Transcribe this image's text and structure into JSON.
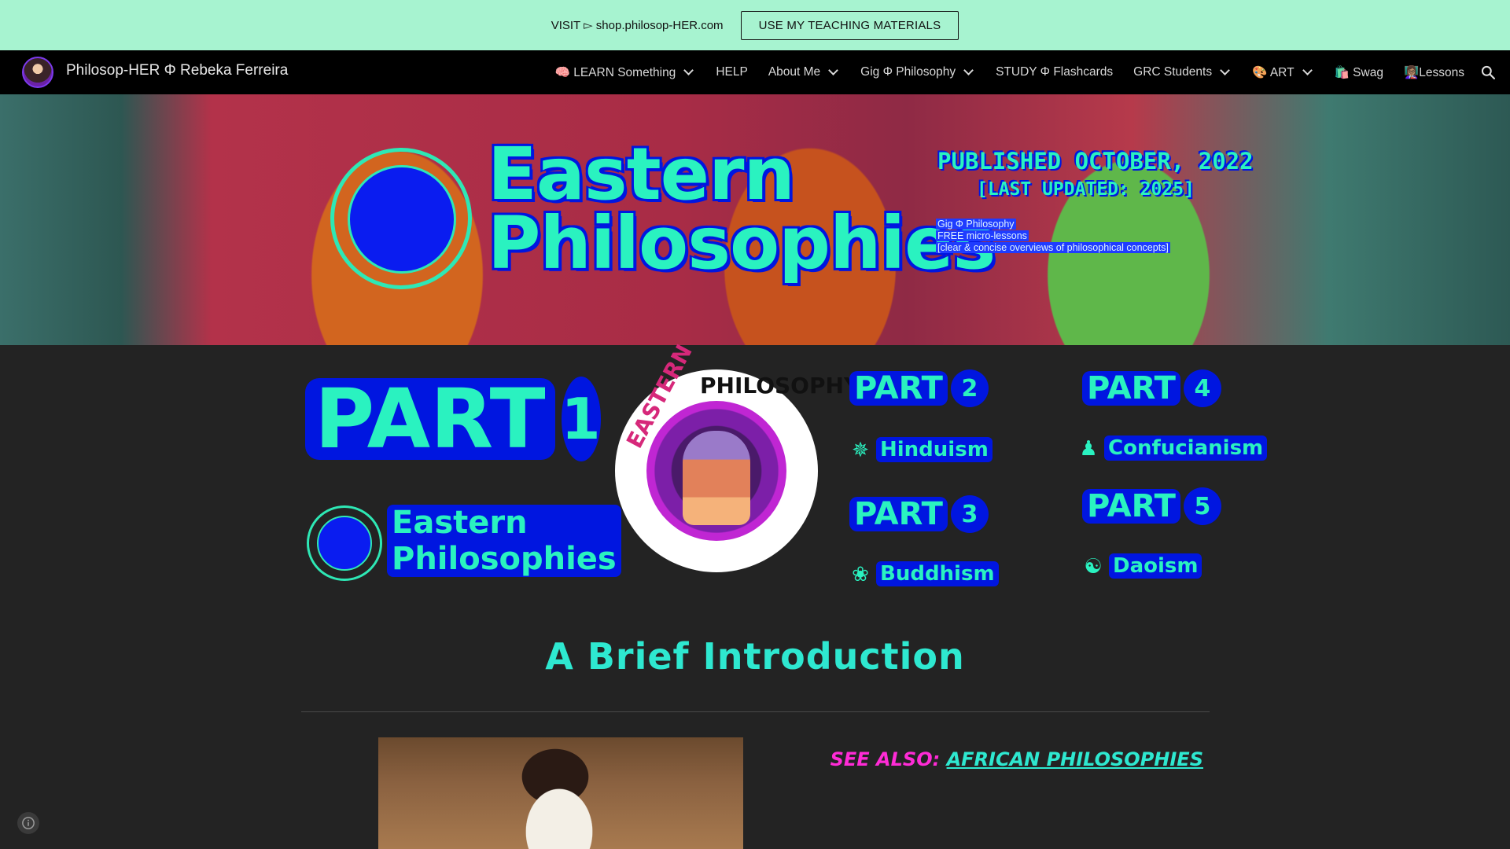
{
  "announcement": {
    "visit_text": "VISIT ▻ shop.philosop-HER.com",
    "button_label": "USE MY TEACHING MATERIALS"
  },
  "nav": {
    "site_title": "Philosop-HER Φ Rebeka Ferreira",
    "items": [
      {
        "label": "🧠 LEARN Something",
        "dropdown": true
      },
      {
        "label": "HELP",
        "dropdown": false
      },
      {
        "label": "About Me",
        "dropdown": true
      },
      {
        "label": "Gig Φ Philosophy",
        "dropdown": true
      },
      {
        "label": "STUDY Φ Flashcards",
        "dropdown": false
      },
      {
        "label": "GRC Students",
        "dropdown": true
      },
      {
        "label": "🎨 ART",
        "dropdown": true
      },
      {
        "label": "🛍️ Swag",
        "dropdown": false
      },
      {
        "label": "👩🏽‍🏫Lessons",
        "dropdown": false
      }
    ]
  },
  "hero": {
    "title_line1": "Eastern",
    "title_line2": "Philosophies",
    "published": "PUBLISHED OCTOBER, 2022",
    "updated": "[LAST UPDATED: 2025]",
    "small1": "Gig Φ Philosophy",
    "small2": "FREE micro-lessons",
    "small3": "[clear & concise overviews of philosophical concepts]"
  },
  "parts": {
    "part_word": "PART",
    "part1_num": "1",
    "small_title_line1": "Eastern",
    "small_title_line2": "Philosophies",
    "badge_word1": "EASTERN",
    "badge_word2": "PHILOSOPHY",
    "part2_num": "2",
    "part3_num": "3",
    "part4_num": "4",
    "part5_num": "5",
    "topic_hinduism": "Hinduism",
    "topic_buddhism": "Buddhism",
    "topic_confucianism": "Confucianism",
    "topic_daoism": "Daoism",
    "icons": {
      "hinduism": "hindu-symbol-icon",
      "buddhism": "lotus-icon",
      "confucianism": "figure-icon",
      "daoism": "yin-yang-icon"
    }
  },
  "intro": {
    "title": "A Brief Introduction",
    "see_also_label": "SEE ALSO:",
    "see_also_link": "AFRICAN PHILOSOPHIES"
  },
  "colors": {
    "announce_bg": "#a7f3d0",
    "nav_bg": "#000000",
    "page_bg": "#232323",
    "accent_teal": "#2af2c0",
    "accent_blue": "#0016e0",
    "accent_pink": "#ff2bd6"
  }
}
